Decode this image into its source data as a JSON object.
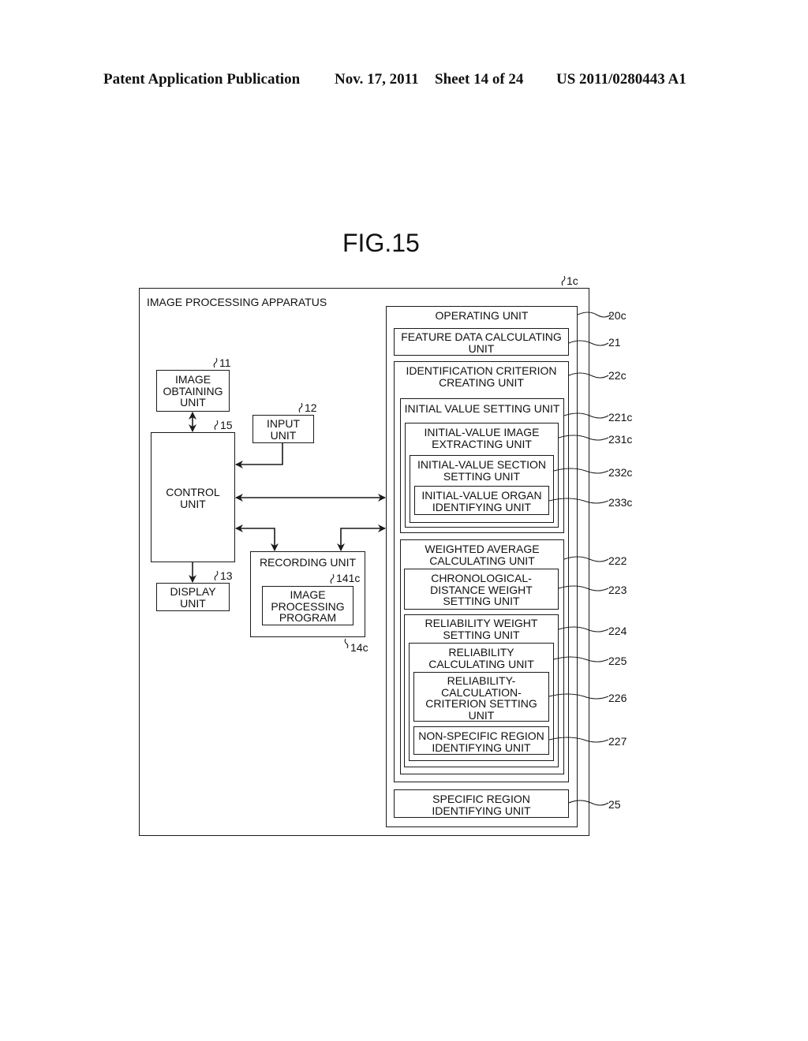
{
  "header": {
    "publication": "Patent Application Publication",
    "date": "Nov. 17, 2011",
    "sheet": "Sheet 14 of 24",
    "number": "US 2011/0280443 A1"
  },
  "figure": {
    "title": "FIG.15",
    "apparatus": {
      "label": "IMAGE PROCESSING APPARATUS",
      "ref": "1c"
    },
    "left_units": {
      "image_obtaining": {
        "label": "IMAGE\nOBTAINING\nUNIT",
        "ref": "11"
      },
      "input": {
        "label": "INPUT\nUNIT",
        "ref": "12"
      },
      "control": {
        "label": "CONTROL\nUNIT",
        "ref": "15"
      },
      "display": {
        "label": "DISPLAY\nUNIT",
        "ref": "13"
      },
      "recording": {
        "label": "RECORDING UNIT",
        "ref": "14c"
      },
      "program": {
        "label": "IMAGE\nPROCESSING\nPROGRAM",
        "ref": "141c"
      }
    },
    "operating_unit": {
      "label": "OPERATING UNIT",
      "ref": "20c",
      "feature_data": {
        "label": "FEATURE DATA CALCULATING\nUNIT",
        "ref": "21"
      },
      "identification": {
        "label": "IDENTIFICATION CRITERION\nCREATING UNIT",
        "ref": "22c",
        "initial_value_setting": {
          "label": "INITIAL VALUE SETTING UNIT",
          "ref": "221c"
        },
        "initial_value_image": {
          "label": "INITIAL-VALUE IMAGE\nEXTRACTING UNIT",
          "ref": "231c"
        },
        "initial_value_section": {
          "label": "INITIAL-VALUE SECTION\nSETTING UNIT",
          "ref": "232c"
        },
        "initial_value_organ": {
          "label": "INITIAL-VALUE ORGAN\nIDENTIFYING UNIT",
          "ref": "233c"
        },
        "weighted_average": {
          "label": "WEIGHTED AVERAGE\nCALCULATING UNIT",
          "ref": "222"
        },
        "chronological": {
          "label": "CHRONOLOGICAL-\nDISTANCE WEIGHT\nSETTING UNIT",
          "ref": "223"
        },
        "reliability_weight": {
          "label": "RELIABILITY WEIGHT\nSETTING UNIT",
          "ref": "224"
        },
        "reliability_calc": {
          "label": "RELIABILITY\nCALCULATING UNIT",
          "ref": "225"
        },
        "reliability_criterion": {
          "label": "RELIABILITY-\nCALCULATION-\nCRITERION SETTING\nUNIT",
          "ref": "226"
        },
        "non_specific": {
          "label": "NON-SPECIFIC REGION\nIDENTIFYING UNIT",
          "ref": "227"
        }
      },
      "specific_region": {
        "label": "SPECIFIC REGION\nIDENTIFYING UNIT",
        "ref": "25"
      }
    }
  }
}
